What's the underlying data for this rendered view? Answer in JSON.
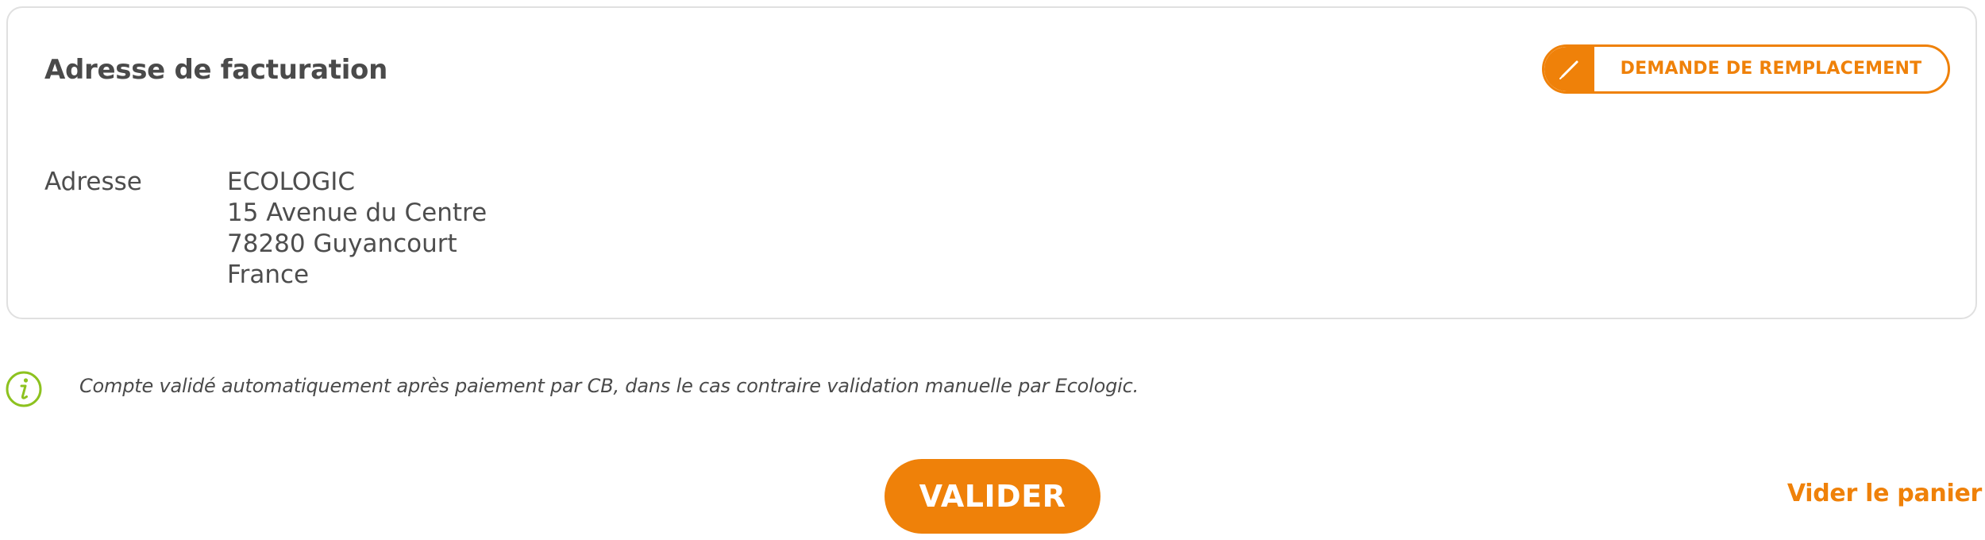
{
  "billing": {
    "title": "Adresse de facturation",
    "replace_button_label": "DEMANDE DE REMPLACEMENT",
    "replace_button_icon": "pencil-icon",
    "address_label": "Adresse",
    "address_lines": [
      "ECOLOGIC",
      "15 Avenue du Centre",
      "78280 Guyancourt",
      "France"
    ]
  },
  "info": {
    "icon": "info-icon",
    "message": "Compte validé automatiquement après paiement par CB, dans le cas contraire validation manuelle par Ecologic."
  },
  "actions": {
    "validate_label": "VALIDER",
    "empty_cart_label": "Vider le panier"
  },
  "colors": {
    "accent": "#ef8109",
    "info_icon": "#8dc21f",
    "text": "#4d4d4d",
    "border": "#e0e0e0"
  }
}
